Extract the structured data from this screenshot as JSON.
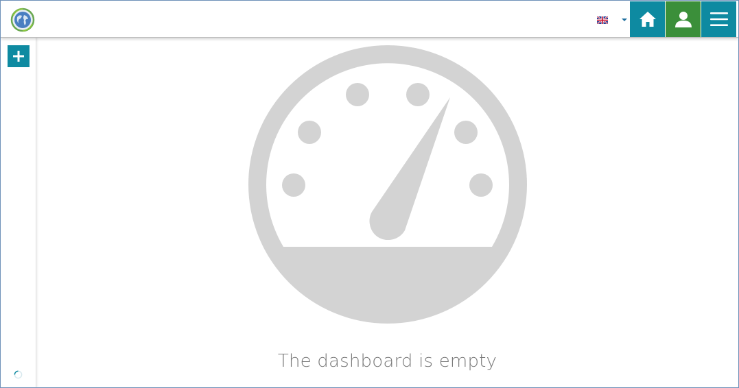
{
  "header": {
    "logo_icon": "globe-logo-icon",
    "language": {
      "icon": "uk-flag-icon",
      "dropdown_icon": "caret-down-icon"
    },
    "buttons": [
      {
        "name": "home",
        "icon": "home-icon",
        "color": "#0e8aa1"
      },
      {
        "name": "user",
        "icon": "user-icon",
        "color": "#3b8f3a"
      },
      {
        "name": "menu",
        "icon": "hamburger-menu-icon",
        "color": "#0e8aa1"
      }
    ]
  },
  "sidebar": {
    "add_icon": "plus-icon",
    "loading_icon": "spinner-icon",
    "accent": "#0e8aa1"
  },
  "main": {
    "illustration_icon": "dashboard-gauge-icon",
    "empty_message": "The dashboard is empty",
    "illustration_color": "#d3d3d3"
  }
}
